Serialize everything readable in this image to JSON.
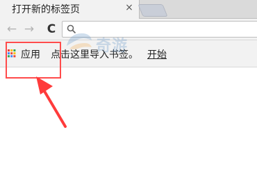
{
  "tab": {
    "title": "打开新的标签页",
    "close_glyph": "×"
  },
  "toolbar": {
    "back_glyph": "←",
    "forward_glyph": "→",
    "reload_glyph": "C"
  },
  "omnibox": {
    "value": "",
    "placeholder": ""
  },
  "bookmarks": {
    "apps_label": "应用",
    "hint": "点击这里导入书签。",
    "start_link": "开始"
  },
  "watermark": {
    "text": "奇游"
  },
  "colors": {
    "highlight": "#ff4b4b",
    "arrow": "#ff3b3b",
    "tabstrip_bg": "#dadada",
    "toolbar_bg": "#f2f2f2",
    "apps_dot_colors": [
      "#ea4335",
      "#fbbc05",
      "#34a853",
      "#4285f4",
      "#ea4335",
      "#fbbc05",
      "#34a853",
      "#4285f4",
      "#ea4335"
    ]
  },
  "icons": [
    "back-icon",
    "forward-icon",
    "reload-icon",
    "search-icon",
    "apps-grid-icon",
    "close-icon"
  ]
}
